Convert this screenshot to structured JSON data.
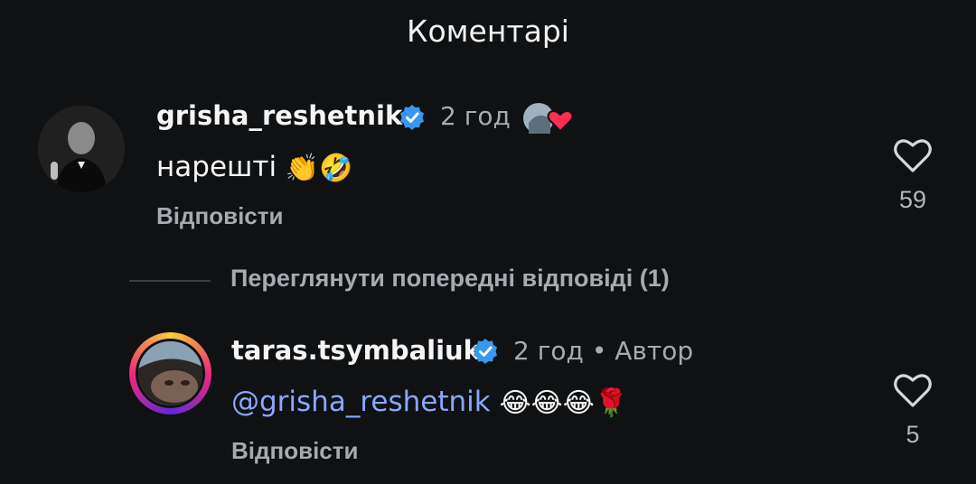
{
  "header": {
    "title": "Коментарі"
  },
  "comments": [
    {
      "username": "grisha_reshetnik",
      "time": "2 год",
      "text": "нарешті",
      "emojis": [
        "👏",
        "🤣"
      ],
      "reply_label": "Відповісти",
      "likes": "59",
      "reaction_icon": "liked-by-creator-heart"
    },
    {
      "username": "taras.tsymbaliuk",
      "time": "2 год",
      "separator": "•",
      "author_label": "Автор",
      "mention": "@grisha_reshetnik",
      "emojis": [
        "😂",
        "😂",
        "😂",
        "🌹"
      ],
      "reply_label": "Відповісти",
      "likes": "5"
    }
  ],
  "replies_toggle": {
    "label": "Переглянути попередні відповіді (1)"
  },
  "colors": {
    "background": "#0f1113",
    "verified": "#3897f0",
    "mention": "#8aa7ff",
    "muted": "#a7aab0"
  }
}
